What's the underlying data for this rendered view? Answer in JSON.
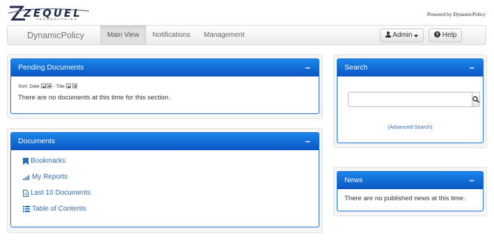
{
  "brand": {
    "logo_word": "ZEQUEL",
    "logo_sub": "TECHNOLOGIES",
    "powered_by": "Powered by DynamicPolicy"
  },
  "navbar": {
    "brand": "DynamicPolicy",
    "tabs": [
      {
        "label": "Main View",
        "active": true
      },
      {
        "label": "Notifications",
        "active": false
      },
      {
        "label": "Management",
        "active": false
      }
    ],
    "admin_label": "Admin",
    "help_label": "Help"
  },
  "pending": {
    "title": "Pending Documents",
    "collapse": "−",
    "sort_label": "Sort:",
    "sort_date": "Date",
    "sort_sep": "-",
    "sort_title": "Title",
    "empty_message": "There are no documents at this time for this section."
  },
  "documents": {
    "title": "Documents",
    "collapse": "−",
    "items": [
      {
        "label": "Bookmarks",
        "icon": "bookmark-icon"
      },
      {
        "label": "My Reports",
        "icon": "signal-icon"
      },
      {
        "label": "Last 10 Documents",
        "icon": "file-icon"
      },
      {
        "label": "Table of Contents",
        "icon": "list-icon"
      }
    ]
  },
  "search": {
    "title": "Search",
    "collapse": "−",
    "placeholder": "",
    "advanced_label": "(Advanced Search)"
  },
  "news": {
    "title": "News",
    "collapse": "−",
    "empty_message": "There are no published news at this time."
  },
  "colors": {
    "panel_header_top": "#1a86ea",
    "panel_header_bottom": "#0b55c4",
    "link": "#2a6db8"
  }
}
